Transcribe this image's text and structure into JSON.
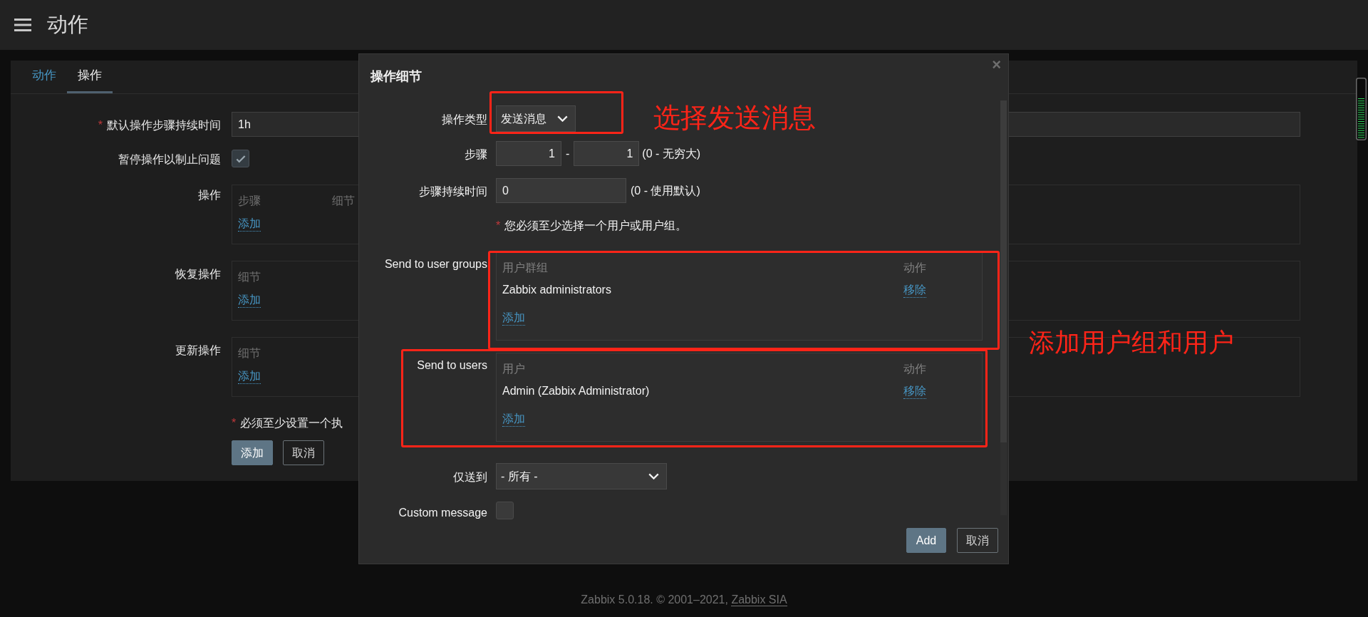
{
  "header": {
    "title": "动作"
  },
  "tabs": [
    {
      "label": "动作",
      "selected": false
    },
    {
      "label": "操作",
      "selected": true
    }
  ],
  "form": {
    "default_step_duration": {
      "label": "默认操作步骤持续时间",
      "required_mark": "*",
      "value": "1h"
    },
    "pause": {
      "label": "暂停操作以制止问题",
      "checked": true
    },
    "sections": [
      {
        "label": "操作",
        "columns": [
          "步骤",
          "细节"
        ],
        "add": "添加"
      },
      {
        "label": "恢复操作",
        "columns": [
          "细节"
        ],
        "add": "添加"
      },
      {
        "label": "更新操作",
        "columns": [
          "细节"
        ],
        "add": "添加"
      }
    ],
    "note": {
      "required_mark": "*",
      "text": "必须至少设置一个执"
    },
    "buttons": [
      {
        "label": "添加",
        "kind": "primary"
      },
      {
        "label": "取消",
        "kind": "secondary"
      }
    ]
  },
  "dialog": {
    "title": "操作细节",
    "close": "×",
    "operation_type": {
      "label": "操作类型",
      "value": "发送消息"
    },
    "steps": {
      "label": "步骤",
      "from": "1",
      "separator": "-",
      "to": "1",
      "hint": "(0 - 无穷大)"
    },
    "step_duration": {
      "label": "步骤持续时间",
      "value": "0",
      "hint": "(0 - 使用默认)"
    },
    "note": {
      "required_mark": "*",
      "text": "您必须至少选择一个用户或用户组。"
    },
    "tables": [
      {
        "label": "Send to user groups",
        "columns": [
          "用户群组",
          "动作"
        ],
        "rows": [
          {
            "name": "Zabbix administrators",
            "action": "移除"
          }
        ],
        "add": "添加"
      },
      {
        "label": "Send to users",
        "columns": [
          "用户",
          "动作"
        ],
        "rows": [
          {
            "name": "Admin (Zabbix Administrator)",
            "action": "移除"
          }
        ],
        "add": "添加"
      }
    ],
    "send_only_to": {
      "label": "仅送到",
      "value": "- 所有 -"
    },
    "custom_message": {
      "label": "Custom message",
      "checked": false
    },
    "buttons": [
      {
        "label": "Add",
        "kind": "primary"
      },
      {
        "label": "取消",
        "kind": "secondary"
      }
    ]
  },
  "annotations": [
    {
      "text": "选择发送消息"
    },
    {
      "text": "添加用户组和用户"
    }
  ],
  "footer": {
    "text": "Zabbix 5.0.18. © 2001–2021, ",
    "link": "Zabbix SIA"
  }
}
